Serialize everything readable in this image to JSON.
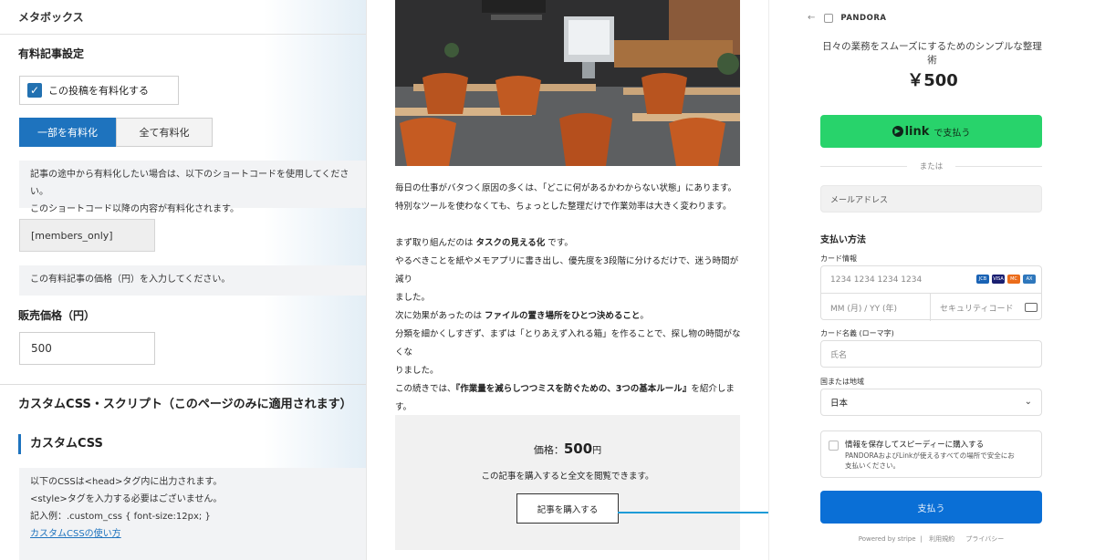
{
  "left": {
    "header": "メタボックス",
    "paid_title": "有料記事設定",
    "checkbox_label": "この投稿を有料化する",
    "tabs": [
      "一部を有料化",
      "全て有料化"
    ],
    "note1_line1": "記事の途中から有料化したい場合は、以下のショートコードを使用してください。",
    "note1_line2": "このショートコード以降の内容が有料化されます。",
    "shortcode": "[members_only]",
    "note2": "この有料記事の価格（円）を入力してください。",
    "price_label": "販売価格（円）",
    "price_value": "500",
    "css_section_title": "カスタムCSS・スクリプト（このページのみに適用されます）",
    "css_subtitle": "カスタムCSS",
    "css_note_line1": "以下のCSSは<head>タグ内に出力されます。",
    "css_note_line2": "<style>タグを入力する必要はございません。",
    "css_note_line3": "記入例：.custom_css { font-size:12px; }",
    "css_link": "カスタムCSSの使い方"
  },
  "article": {
    "p1_line1": "毎日の仕事がバタつく原因の多くは、「どこに何があるかわからない状態」にあります。",
    "p1_line2": "特別なツールを使わなくても、ちょっとした整理だけで作業効率は大きく変わります。",
    "p2_prefix": "まず取り組んだのは ",
    "p2_bold": "タスクの見える化",
    "p2_suffix": " です。",
    "p2_line2": "やるべきことを紙やメモアプリに書き出し、優先度を3段階に分けるだけで、迷う時間が減り",
    "p2_line3": "ました。",
    "p3_prefix": "次に効果があったのは ",
    "p3_bold": "ファイルの置き場所をひとつ決めること",
    "p3_suffix": "。",
    "p3_line2": "分類を細かくしすぎず、まずは「とりあえず入れる箱」を作ることで、探し物の時間がなくな",
    "p3_line3": "りました。",
    "p4_prefix": "この続きでは、",
    "p4_bold": "『作業量を減らしつつミスを防ぐための、3つの基本ルール』",
    "p4_suffix": "を紹介します。",
    "price_prefix": "価格：",
    "price_value": "500",
    "price_unit": "円",
    "paywall_desc": "この記事を購入すると全文を閲覧できます。",
    "buy_button": "記事を購入する"
  },
  "checkout": {
    "brand": "PANDORA",
    "product_name": "日々の業務をスムーズにするためのシンプルな整理術",
    "amount": "￥500",
    "link_logo": "link",
    "link_suffix": "で支払う",
    "or": "または",
    "email_placeholder": "メールアドレス",
    "payment_method_title": "支払い方法",
    "card_info_label": "カード情報",
    "card_number_placeholder": "1234 1234 1234 1234",
    "expiry_placeholder": "MM (月) / YY (年)",
    "cvc_placeholder": "セキュリティコード",
    "card_name_label": "カード名義 (ローマ字)",
    "card_name_placeholder": "氏名",
    "country_label": "国または地域",
    "country_value": "日本",
    "save_title": "情報を保存してスピーディーに購入する",
    "save_desc_line1": "PANDORAおよびLinkが使えるすべての場所で安全にお",
    "save_desc_line2": "支払いください。",
    "pay_button": "支払う",
    "footer_powered": "Powered by stripe",
    "footer_terms": "利用規約",
    "footer_privacy": "プライバシー",
    "colors": {
      "link_green": "#28d36b",
      "pay_blue": "#0a6fd6",
      "wp_blue": "#1e73be"
    }
  }
}
